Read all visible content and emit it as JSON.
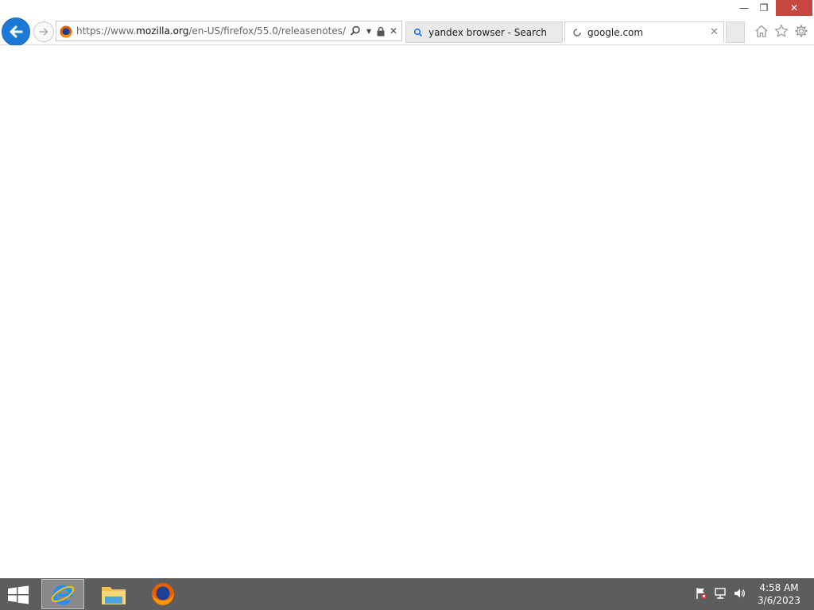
{
  "window": {
    "minimize_glyph": "—",
    "restore_glyph": "❐",
    "close_glyph": "✕"
  },
  "nav": {
    "back_icon": "back-arrow-icon",
    "forward_icon": "forward-arrow-icon"
  },
  "address_bar": {
    "url_prefix": "https://www.",
    "url_domain": "mozilla.org",
    "url_path": "/en-US/firefox/55.0/releasenotes/",
    "favicon": "firefox-favicon",
    "search_glyph": "⌕",
    "dropdown_glyph": "▾",
    "stop_glyph": "✕"
  },
  "tabs": [
    {
      "label": "yandex browser - Search",
      "icon": "search-icon",
      "active": false
    },
    {
      "label": "google.com",
      "icon": "loading-icon",
      "active": true,
      "close_glyph": "✕"
    }
  ],
  "toolbar": {
    "home_icon": "home-icon",
    "favorites_icon": "star-icon",
    "tools_icon": "gear-icon"
  },
  "taskbar": {
    "apps": [
      "internet-explorer",
      "file-explorer",
      "firefox"
    ],
    "tray_icons": [
      "action-center-flag",
      "network",
      "volume"
    ]
  },
  "clock": {
    "time": "4:58 AM",
    "date": "3/6/2023"
  },
  "colors": {
    "accent_blue": "#1e78d6",
    "close_red": "#c7463f",
    "taskbar": "#5d5d5d"
  }
}
